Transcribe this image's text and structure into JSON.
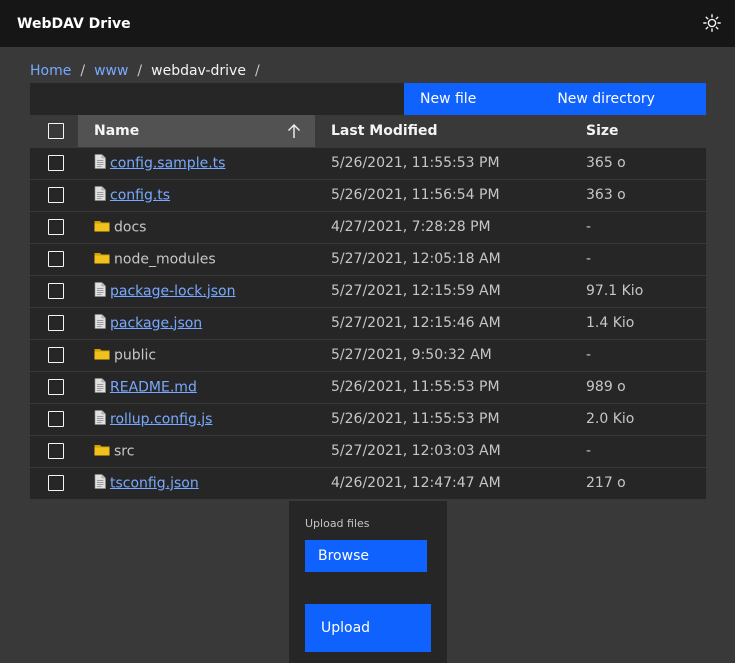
{
  "app": {
    "title": "WebDAV Drive",
    "theme_icon": "sun-icon"
  },
  "breadcrumb": {
    "items": [
      {
        "label": "Home"
      },
      {
        "label": "www"
      }
    ],
    "current": "webdav-drive",
    "separator": "/"
  },
  "toolbar": {
    "new_file": "New file",
    "new_directory": "New directory"
  },
  "table": {
    "headers": {
      "name": "Name",
      "modified": "Last Modified",
      "size": "Size"
    },
    "sort": {
      "column": "name",
      "direction": "ascending",
      "icon": "arrow-up-icon"
    },
    "rows": [
      {
        "type": "file",
        "name": "config.sample.ts",
        "modified": "5/26/2021, 11:55:53 PM",
        "size": "365 o"
      },
      {
        "type": "file",
        "name": "config.ts",
        "modified": "5/26/2021, 11:56:54 PM",
        "size": "363 o"
      },
      {
        "type": "dir",
        "name": "docs",
        "modified": "4/27/2021, 7:28:28 PM",
        "size": "-"
      },
      {
        "type": "dir",
        "name": "node_modules",
        "modified": "5/27/2021, 12:05:18 AM",
        "size": "-"
      },
      {
        "type": "file",
        "name": "package-lock.json",
        "modified": "5/27/2021, 12:15:59 AM",
        "size": "97.1 Kio"
      },
      {
        "type": "file",
        "name": "package.json",
        "modified": "5/27/2021, 12:15:46 AM",
        "size": "1.4 Kio"
      },
      {
        "type": "dir",
        "name": "public",
        "modified": "5/27/2021, 9:50:32 AM",
        "size": "-"
      },
      {
        "type": "file",
        "name": "README.md",
        "modified": "5/26/2021, 11:55:53 PM",
        "size": "989 o"
      },
      {
        "type": "file",
        "name": "rollup.config.js",
        "modified": "5/26/2021, 11:55:53 PM",
        "size": "2.0 Kio"
      },
      {
        "type": "dir",
        "name": "src",
        "modified": "5/27/2021, 12:03:03 AM",
        "size": "-"
      },
      {
        "type": "file",
        "name": "tsconfig.json",
        "modified": "4/26/2021, 12:47:47 AM",
        "size": "217 o"
      }
    ]
  },
  "upload": {
    "label": "Upload files",
    "browse": "Browse",
    "upload": "Upload"
  },
  "colors": {
    "accent": "#0f62fe",
    "link": "#78a9ff",
    "header_bg": "#161616",
    "page_bg": "#393939",
    "row_bg": "#262626",
    "folder": "#f1c21b"
  }
}
